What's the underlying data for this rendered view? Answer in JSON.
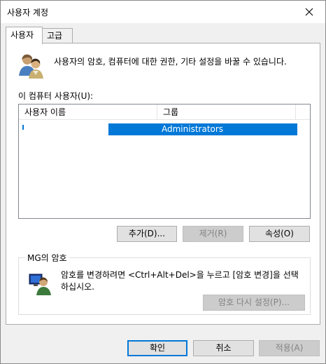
{
  "window": {
    "title": "사용자 계정"
  },
  "tabs": [
    {
      "label": "사용자"
    },
    {
      "label": "고급"
    }
  ],
  "intro_text": "사용자의 암호, 컴퓨터에 대한 권한, 기타 설정을 바꿀 수 있습니다.",
  "users_list": {
    "label": "이 컴퓨터 사용자(U):",
    "columns": [
      "사용자 이름",
      "그룹"
    ],
    "rows": [
      {
        "user": "",
        "group": "Administrators",
        "selected": true
      }
    ]
  },
  "user_buttons": {
    "add": "추가(D)...",
    "remove": "제거(R)",
    "properties": "속성(O)"
  },
  "password_group": {
    "title": "MG의 암호",
    "text": "암호를 변경하려면 <Ctrl+Alt+Del>을 누르고 [암호 변경]을 선택하십시오.",
    "reset_button": "암호 다시 설정(P)..."
  },
  "dialog_buttons": {
    "ok": "확인",
    "cancel": "취소",
    "apply": "적용(A)"
  },
  "colors": {
    "selection": "#0078d7",
    "disabled_text": "#838383"
  },
  "icons": {
    "close": "close-icon",
    "users": "users-icon",
    "password": "password-user-icon"
  }
}
